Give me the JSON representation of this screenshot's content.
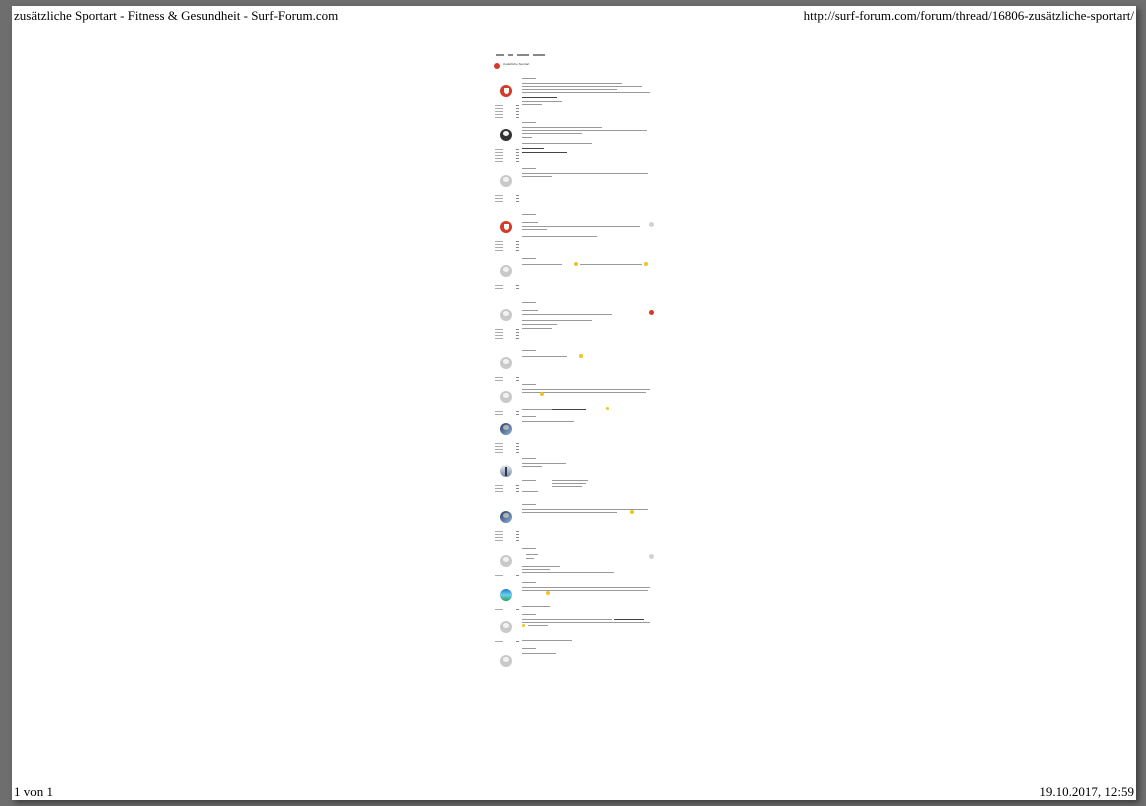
{
  "header": {
    "title": "zusätzliche Sportart - Fitness & Gesundheit - Surf-Forum.com",
    "url": "http://surf-forum.com/forum/thread/16806-zusätzliche-sportart/"
  },
  "footer": {
    "page_indicator": "1 von 1",
    "datetime": "19.10.2017, 12:59"
  },
  "thread": {
    "title": "zusätzliche Sportart",
    "colors": {
      "brand": "#d43a2a",
      "smiley": "#f3c320"
    }
  }
}
